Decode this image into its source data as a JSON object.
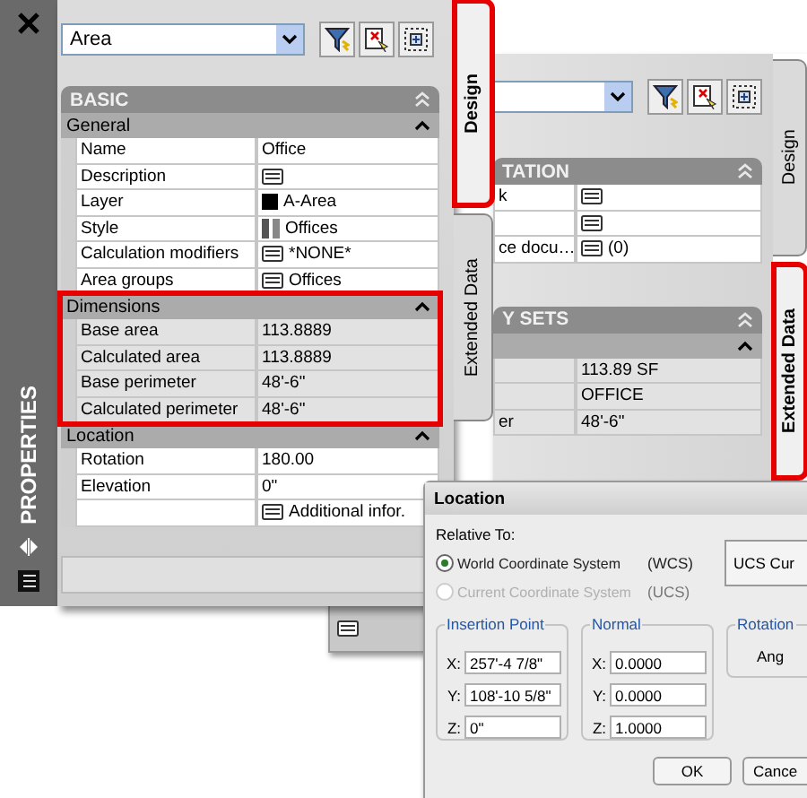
{
  "front_palette": {
    "title": "PROPERTIES",
    "selector": {
      "value": "Area"
    },
    "sections": [
      {
        "title": "BASIC",
        "groups": [
          {
            "title": "General",
            "expanded": true,
            "highlighted": false,
            "rows": [
              {
                "label": "Name",
                "value": "Office"
              },
              {
                "label": "Description",
                "kind": "button"
              },
              {
                "label": "Layer",
                "value": "A-Area",
                "kind": "swatch"
              },
              {
                "label": "Style",
                "value": "Offices",
                "kind": "style"
              },
              {
                "label": "Calculation modifiers",
                "value": "*NONE*",
                "kind": "button"
              },
              {
                "label": "Area groups",
                "value": "Offices",
                "kind": "button"
              }
            ]
          },
          {
            "title": "Dimensions",
            "expanded": true,
            "highlighted": true,
            "rows": [
              {
                "label": "Base area",
                "value": "113.8889",
                "readonly": true
              },
              {
                "label": "Calculated area",
                "value": "113.8889",
                "readonly": true
              },
              {
                "label": "Base perimeter",
                "value": "48'-6\"",
                "readonly": true
              },
              {
                "label": "Calculated perimeter",
                "value": "48'-6\"",
                "readonly": true
              }
            ]
          },
          {
            "title": "Location",
            "expanded": true,
            "highlighted": false,
            "rows": [
              {
                "label": "Rotation",
                "value": "180.00"
              },
              {
                "label": "Elevation",
                "value": "0\""
              },
              {
                "value": "Additional infor.",
                "kind": "button"
              }
            ]
          }
        ]
      }
    ],
    "tabs": [
      {
        "label": "Design",
        "selected": true,
        "highlighted": true
      },
      {
        "label": "Extended Data",
        "selected": false,
        "highlighted": false
      }
    ]
  },
  "back_palette": {
    "sections": [
      {
        "title": "TATION",
        "rows": [
          {
            "label": "k",
            "kind": "button"
          },
          {
            "kind": "button"
          },
          {
            "label": "ce docu…",
            "value": "(0)",
            "kind": "button"
          }
        ]
      },
      {
        "title": "Y SETS",
        "groups": [
          {
            "expanded": true,
            "rows": [
              {
                "value": "113.89 SF",
                "readonly": true
              },
              {
                "value": "OFFICE",
                "readonly": true
              },
              {
                "label": "er",
                "value": "48'-6\"",
                "readonly": true
              }
            ]
          }
        ]
      }
    ],
    "tabs": [
      {
        "label": "Design",
        "selected": false,
        "highlighted": false
      },
      {
        "label": "Extended Data",
        "selected": true,
        "highlighted": true
      }
    ]
  },
  "dialog": {
    "title": "Location",
    "relative_label": "Relative To:",
    "options": [
      {
        "label": "World Coordinate System",
        "abbr": "(WCS)",
        "selected": true,
        "disabled": false
      },
      {
        "label": "Current Coordinate System",
        "abbr": "(UCS)",
        "selected": false,
        "disabled": true
      }
    ],
    "ucs_button": "UCS Cur",
    "groups": [
      {
        "title": "Insertion Point",
        "fields": [
          {
            "axis": "X:",
            "value": "257'-4 7/8\""
          },
          {
            "axis": "Y:",
            "value": "108'-10 5/8\""
          },
          {
            "axis": "Z:",
            "value": "0\""
          }
        ]
      },
      {
        "title": "Normal",
        "fields": [
          {
            "axis": "X:",
            "value": "0.0000"
          },
          {
            "axis": "Y:",
            "value": "0.0000"
          },
          {
            "axis": "Z:",
            "value": "1.0000"
          }
        ]
      }
    ],
    "rotation": {
      "title": "Rotation",
      "label": "Ang"
    },
    "buttons": [
      "OK",
      "Cance"
    ]
  }
}
